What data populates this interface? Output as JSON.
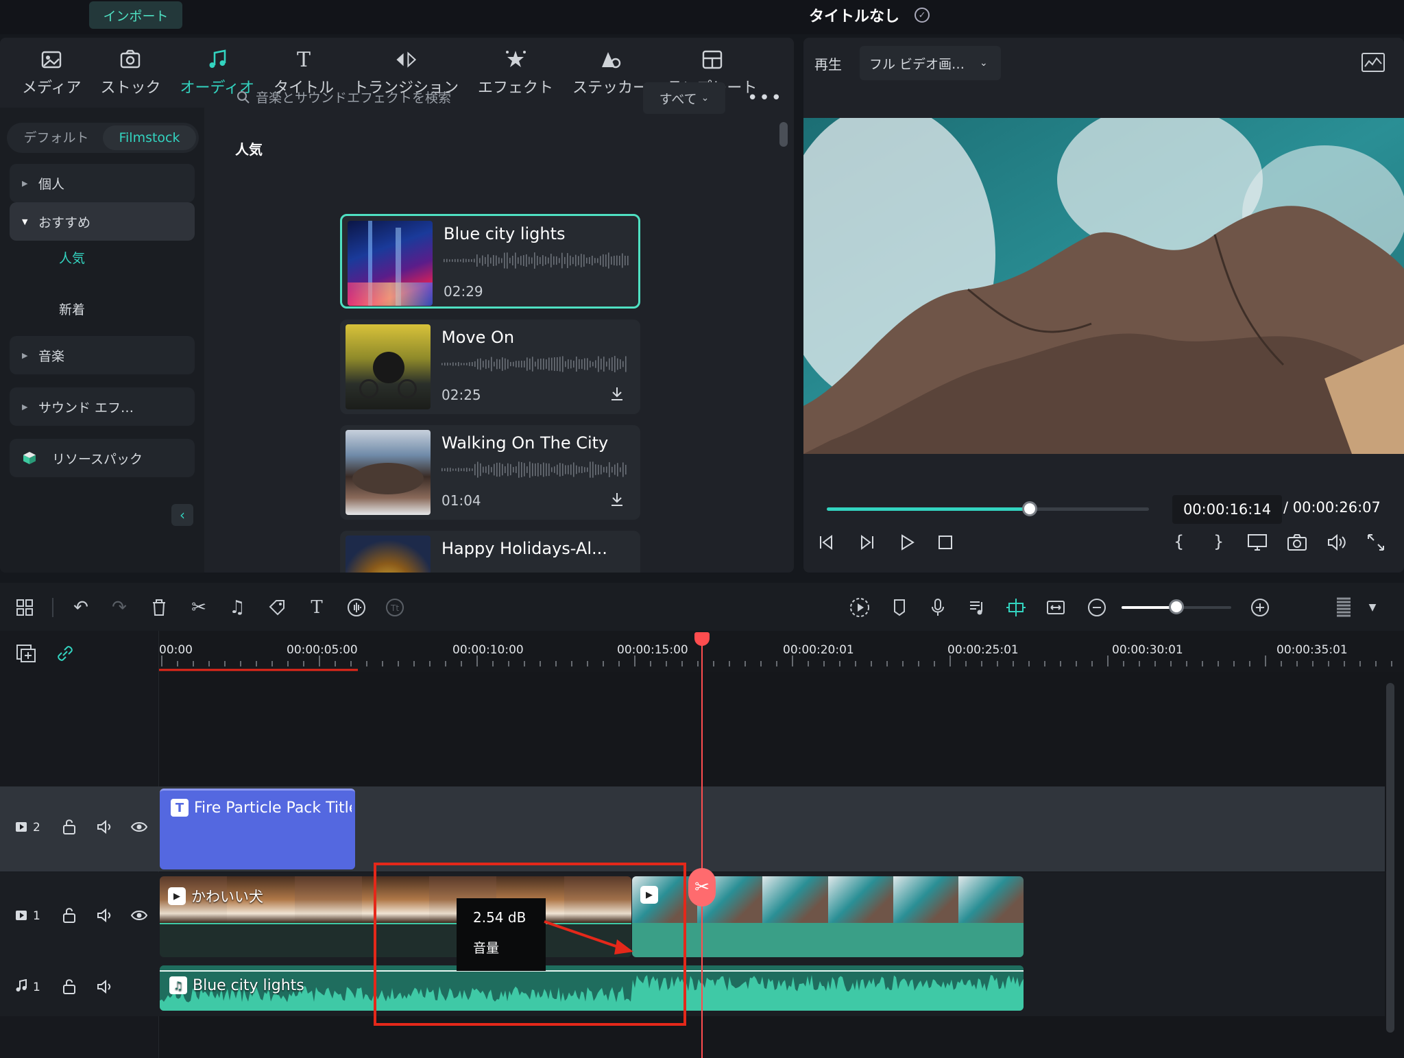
{
  "topbar": {
    "import_label": "インポート",
    "project_title": "タイトルなし"
  },
  "library": {
    "tabs": [
      {
        "label": "メディア",
        "icon": "media-icon"
      },
      {
        "label": "ストック",
        "icon": "stock-icon"
      },
      {
        "label": "オーディオ",
        "icon": "audio-icon",
        "active": true
      },
      {
        "label": "タイトル",
        "icon": "title-icon"
      },
      {
        "label": "トランジション",
        "icon": "transition-icon"
      },
      {
        "label": "エフェクト",
        "icon": "effect-icon"
      },
      {
        "label": "ステッカー",
        "icon": "sticker-icon"
      },
      {
        "label": "テンプレート",
        "icon": "template-icon"
      }
    ],
    "switch": {
      "default": "デフォルト",
      "filmstock": "Filmstock"
    },
    "categories": {
      "personal": "個人",
      "recommended": "おすすめ",
      "popular": "人気",
      "new": "新着",
      "music": "音楽",
      "sound_effects": "サウンド エフ…",
      "resource_pack": "リソースパック"
    },
    "search_placeholder": "音楽とサウンドエフェクトを検索",
    "filter_label": "すべて",
    "section_title": "人気",
    "tracks": [
      {
        "name": "Blue city lights",
        "duration": "02:29",
        "selected": true
      },
      {
        "name": "Move On",
        "duration": "02:25"
      },
      {
        "name": "Walking On The City",
        "duration": "01:04"
      },
      {
        "name": "Happy Holidays-Al..."
      }
    ]
  },
  "preview": {
    "play_label": "再生",
    "quality_label": "フル ビデオ画…",
    "progress": 0.63,
    "current_time": "00:00:16:14",
    "total_time": "/ 00:00:26:07"
  },
  "timeline": {
    "zoom": 0.5,
    "ruler": [
      "00:00",
      "00:00:05:00",
      "00:00:10:00",
      "00:00:15:00",
      "00:00:20:01",
      "00:00:25:01",
      "00:00:30:01",
      "00:00:35:01"
    ],
    "tracks": {
      "video2": "2",
      "video1": "1",
      "audio1": "1"
    },
    "clips": {
      "title_clip": "Fire Particle Pack Title",
      "video_clip": "かわいい犬",
      "audio_clip": "Blue city lights"
    },
    "tooltip": {
      "value": "2.54 dB",
      "label": "音量"
    }
  },
  "colors": {
    "accent": "#33d4c0",
    "title_clip": "#5468e0",
    "audio_clip": "#3fc9a6",
    "playhead": "#ff4d4f",
    "highlight": "#e4281a"
  }
}
